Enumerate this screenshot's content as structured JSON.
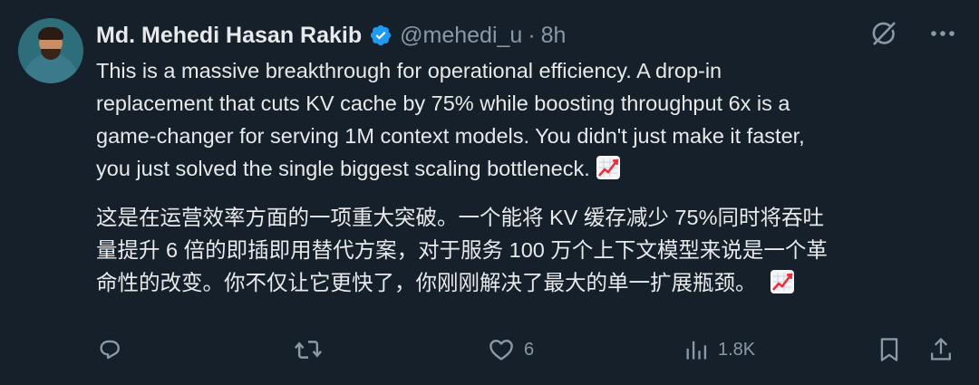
{
  "author": {
    "name": "Md. Mehedi Hasan Rakib",
    "handle": "@mehedi_u",
    "separator": "·",
    "time": "8h"
  },
  "tweet": {
    "english_lines": [
      "This is a massive breakthrough for operational efficiency. A drop-in",
      "replacement that cuts KV cache by 75% while boosting throughput 6x is a",
      "game-changer for serving 1M context models. You didn't just make it faster,",
      "you just solved the single biggest scaling bottleneck."
    ],
    "chinese_lines": [
      "这是在运营效率方面的一项重大突破。一个能将 KV 缓存减少 75%同时将吞吐",
      "量提升 6 倍的即插即用替代方案，对于服务 100 万个上下文模型来说是一个革",
      "命性的改变。你不仅让它更快了，你刚刚解决了最大的单一扩展瓶颈。"
    ]
  },
  "actions": {
    "likes": "6",
    "views": "1.8K"
  },
  "icons": {
    "verified": "verified-badge-icon",
    "grok": "grok-icon",
    "more": "more-icon",
    "reply": "reply-icon",
    "retweet": "retweet-icon",
    "like": "heart-icon",
    "views": "views-icon",
    "bookmark": "bookmark-icon",
    "share": "share-icon",
    "emoji": "chart-increasing-emoji"
  },
  "colors": {
    "background": "#15202b",
    "text": "#e7e9ea",
    "muted": "#8b98a5",
    "verified": "#1d9bf0"
  }
}
